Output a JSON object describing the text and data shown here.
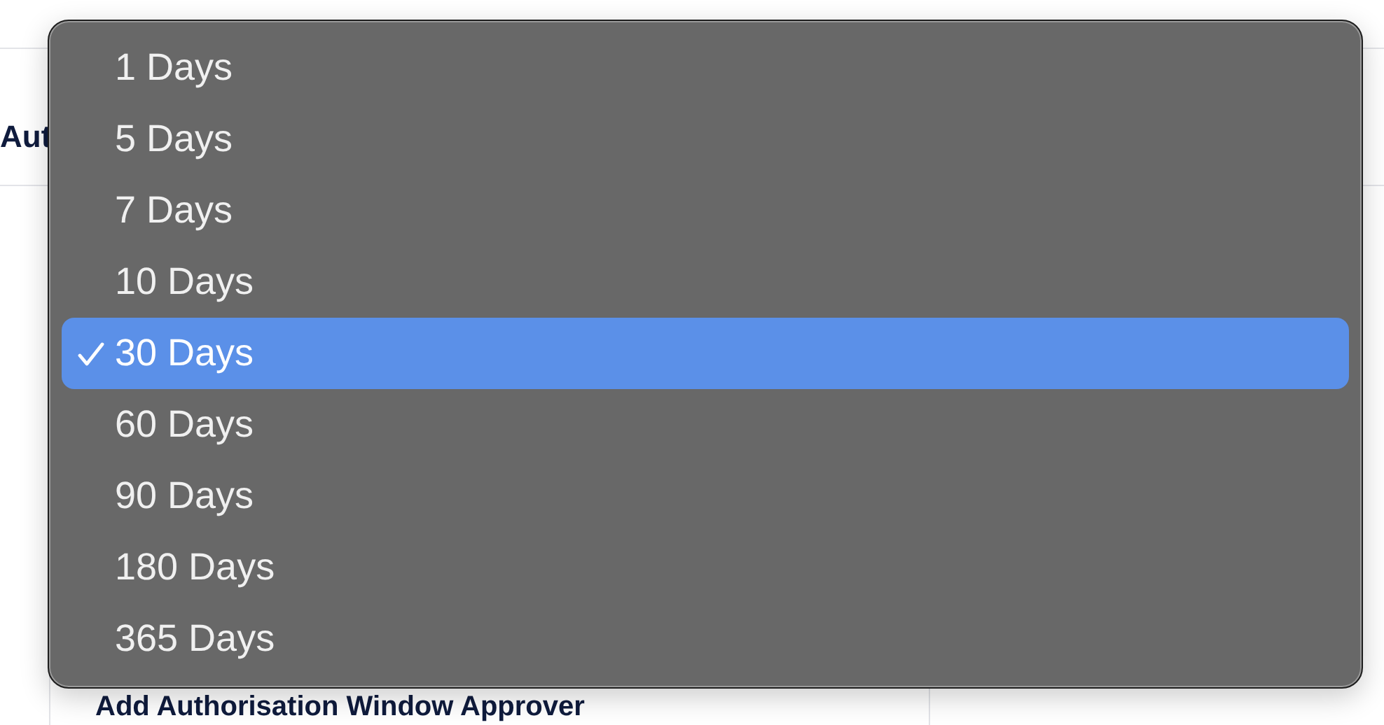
{
  "background": {
    "heading": "Aut",
    "panel_title": "Add Authorisation Window Approver"
  },
  "dropdown": {
    "options": [
      {
        "label": "1 Days",
        "selected": false
      },
      {
        "label": "5 Days",
        "selected": false
      },
      {
        "label": "7 Days",
        "selected": false
      },
      {
        "label": "10 Days",
        "selected": false
      },
      {
        "label": "30 Days",
        "selected": true
      },
      {
        "label": "60 Days",
        "selected": false
      },
      {
        "label": "90 Days",
        "selected": false
      },
      {
        "label": "180 Days",
        "selected": false
      },
      {
        "label": "365 Days",
        "selected": false
      }
    ]
  }
}
